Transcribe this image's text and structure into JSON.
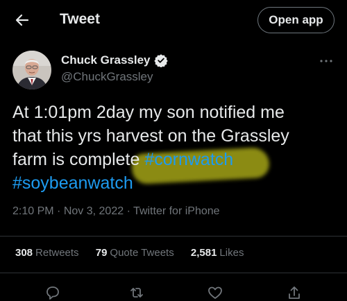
{
  "header": {
    "title": "Tweet",
    "open_app_label": "Open app"
  },
  "author": {
    "name": "Chuck Grassley",
    "handle": "@ChuckGrassley"
  },
  "tweet": {
    "line1": "At 1:01pm 2day my son notified me",
    "line2": "that this yrs harvest on the Grassley",
    "line3_text": "farm is complete ",
    "hashtag1": "#cornwatch",
    "hashtag2": "#soybeanwatch",
    "time": "2:10 PM",
    "date": "Nov 3, 2022",
    "source": "Twitter for iPhone",
    "separator": "·"
  },
  "stats": {
    "retweets_count": "308",
    "retweets_label": "Retweets",
    "quotes_count": "79",
    "quotes_label": "Quote Tweets",
    "likes_count": "2,581",
    "likes_label": "Likes"
  },
  "colors": {
    "background": "#000000",
    "text": "#e7e9ea",
    "secondary_text": "#71767b",
    "link": "#1d9bf0",
    "highlight": "#e1e11e"
  },
  "icons": [
    "back-arrow-icon",
    "verified-badge-icon",
    "more-icon",
    "reply-icon",
    "retweet-icon",
    "like-icon",
    "share-icon"
  ]
}
